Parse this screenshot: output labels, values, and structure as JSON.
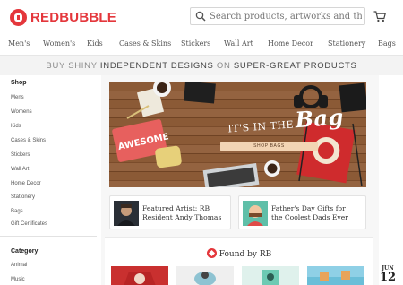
{
  "header": {
    "brand": "REDBUBBLE",
    "search_placeholder": "Search products, artworks and themes"
  },
  "nav": {
    "items": [
      "Men's",
      "Women's",
      "Kids",
      "Cases & Skins",
      "Stickers",
      "Wall Art",
      "Home Decor",
      "Stationery",
      "Bags"
    ]
  },
  "banner": {
    "part1": "BUY SHINY ",
    "part2": "INDEPENDENT DESIGNS",
    "part3": " ON ",
    "part4": "SUPER-GREAT PRODUCTS"
  },
  "sidebar": {
    "shop_heading": "Shop",
    "shop_items": [
      "Mens",
      "Womens",
      "Kids",
      "Cases & Skins",
      "Stickers",
      "Wall Art",
      "Home Decor",
      "Stationery",
      "Bags",
      "Gift Certificates"
    ],
    "category_heading": "Category",
    "category_items": [
      "Animal",
      "Music"
    ]
  },
  "hero": {
    "title_small": "IT'S IN THE",
    "title_big": "Bag",
    "button_label": "SHOP BAGS",
    "pouch_text": "AWESOME"
  },
  "features": [
    {
      "line1": "Featured Artist: RB",
      "line2": "Resident Andy Thomas"
    },
    {
      "line1": "Father's Day Gifts for",
      "line2": "the Coolest Dads Ever"
    }
  ],
  "found": {
    "title": "Found by RB"
  },
  "date_badge": {
    "month": "JUN",
    "day": "12"
  },
  "colors": {
    "brand_red": "#e4373c",
    "banner_bg": "#f3f3f3"
  }
}
